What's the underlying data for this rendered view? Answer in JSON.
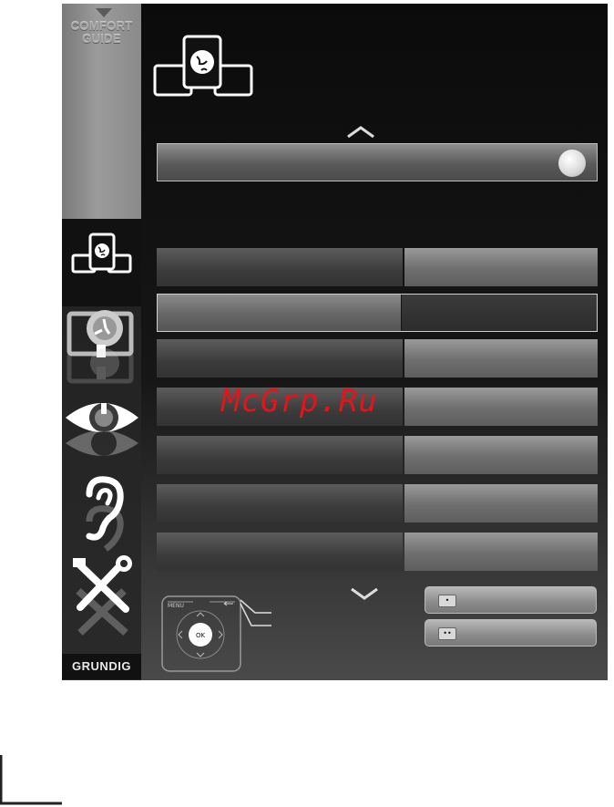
{
  "sidebar": {
    "comfort_guide_line1": "COMFORT",
    "comfort_guide_line2": "GUIDE",
    "icons": [
      "globe-screens-icon",
      "satellite-dish-icon",
      "eye-icon",
      "ear-icon",
      "tools-icon"
    ],
    "brand": "GRUNDIG"
  },
  "remote": {
    "menu_label": "MENU",
    "ok_label": "OK"
  },
  "buttons": {
    "red_dot": "•",
    "green_dots": "••"
  },
  "watermark": "McGrp.Ru",
  "colors": {
    "watermark": "#e0161b",
    "panel_bg": "#111111"
  }
}
